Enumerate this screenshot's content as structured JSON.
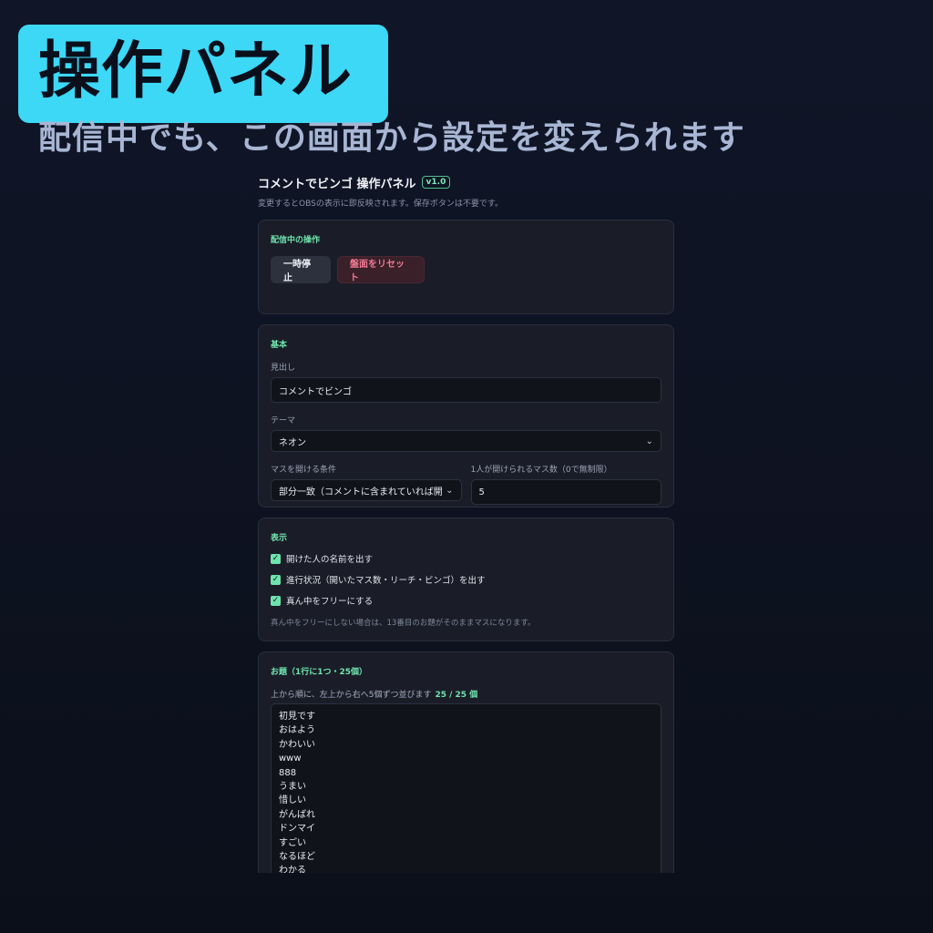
{
  "hero": {
    "title": "操作パネル",
    "subtitle": "配信中でも、この画面から設定を変えられます"
  },
  "app": {
    "title": "コメントでビンゴ 操作パネル",
    "version": "v1.0",
    "description": "変更するとOBSの表示に即反映されます。保存ボタンは不要です。"
  },
  "live_ops": {
    "title": "配信中の操作",
    "pause_label": "一時停止",
    "reset_label": "盤面をリセット"
  },
  "basic": {
    "title": "基本",
    "heading_label": "見出し",
    "heading_value": "コメントでビンゴ",
    "theme_label": "テーマ",
    "theme_value": "ネオン",
    "condition_label": "マスを開ける条件",
    "condition_value": "部分一致（コメントに含まれていれば開",
    "limit_label": "1人が開けられるマス数（0で無制限）",
    "limit_value": "5"
  },
  "display": {
    "title": "表示",
    "options": [
      {
        "label": "開けた人の名前を出す",
        "checked": true
      },
      {
        "label": "進行状況（開いたマス数・リーチ・ビンゴ）を出す",
        "checked": true
      },
      {
        "label": "真ん中をフリーにする",
        "checked": true
      }
    ],
    "hint": "真ん中をフリーにしない場合は、13番目のお題がそのままマスになります。"
  },
  "topics": {
    "title": "お題（1行に1つ・25個）",
    "subtitle": "上から順に、左上から右へ5個ずつ並びます",
    "count": "25 / 25 個",
    "items": [
      "初見です",
      "おはよう",
      "かわいい",
      "www",
      "888",
      "うまい",
      "惜しい",
      "がんばれ",
      "ドンマイ",
      "すごい",
      "なるほど",
      "わかる"
    ]
  },
  "colors": {
    "accent": "#3cd8f6",
    "green": "#6fe3ad",
    "danger": "#f47a93"
  }
}
